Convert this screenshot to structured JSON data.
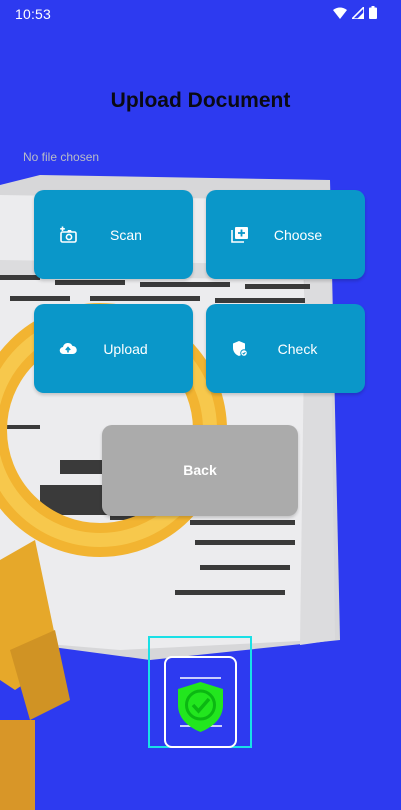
{
  "status_bar": {
    "time": "10:53"
  },
  "title": "Upload Document",
  "file_status": "No file chosen",
  "actions": {
    "scan": {
      "label": "Scan",
      "icon": "camera-plus-icon"
    },
    "choose": {
      "label": "Choose",
      "icon": "add-to-library-icon"
    },
    "upload": {
      "label": "Upload",
      "icon": "cloud-upload-icon"
    },
    "check": {
      "label": "Check",
      "icon": "shield-check-icon"
    }
  },
  "back_label": "Back",
  "colors": {
    "background": "#2d3af0",
    "button": "#0a97c9",
    "back_button": "#ababab",
    "logo_shield": "#22e61e",
    "logo_frame": "#19e0e6"
  }
}
